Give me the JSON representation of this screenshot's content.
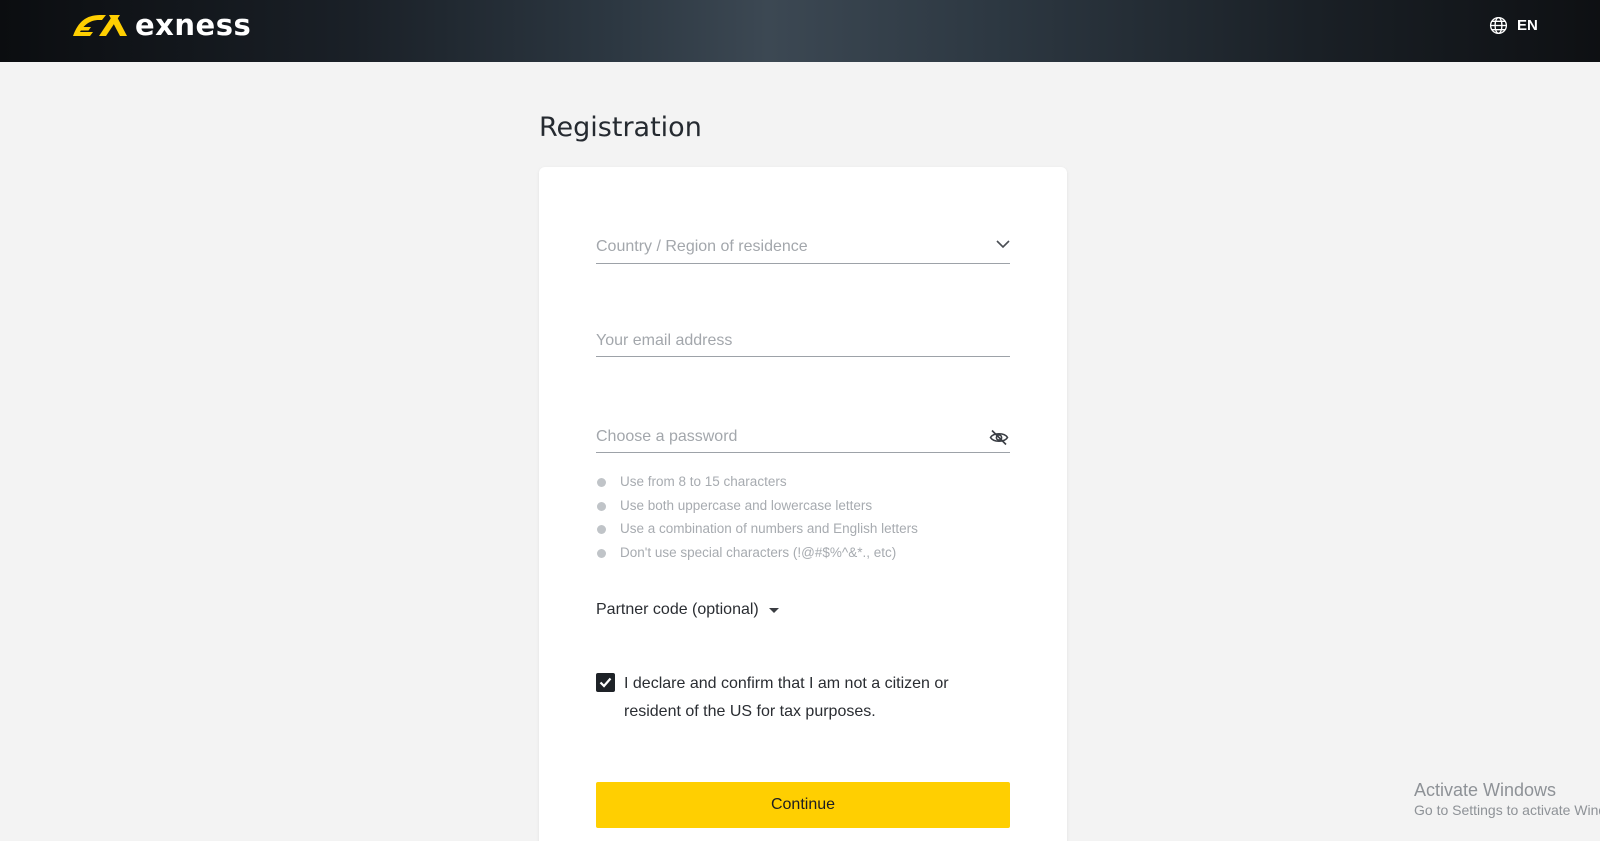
{
  "header": {
    "brand_name": "exness",
    "language": "EN"
  },
  "page": {
    "title": "Registration"
  },
  "form": {
    "country_placeholder": "Country / Region of residence",
    "email_placeholder": "Your email address",
    "password_placeholder": "Choose a password",
    "password_rules": [
      "Use from 8 to 15 characters",
      "Use both uppercase and lowercase letters",
      "Use a combination of numbers and English letters",
      "Don't use special characters (!@#$%^&*., etc)"
    ],
    "partner_code_label": "Partner code (optional)",
    "declaration_text": "I declare and confirm that I am not a citizen or resident of the US for tax purposes.",
    "declaration_checked": true,
    "continue_label": "Continue"
  },
  "watermark": {
    "line1": "Activate Windows",
    "line2": "Go to Settings to activate Windows."
  },
  "colors": {
    "accent": "#ffcf01",
    "header_dark": "#0b0d10",
    "background": "#f3f3f3"
  },
  "icons": {
    "language": "globe-icon",
    "country_dropdown": "chevron-down-icon",
    "password_toggle": "eye-off-icon",
    "partner_toggle": "caret-down-icon",
    "checkbox": "checkmark-icon"
  }
}
